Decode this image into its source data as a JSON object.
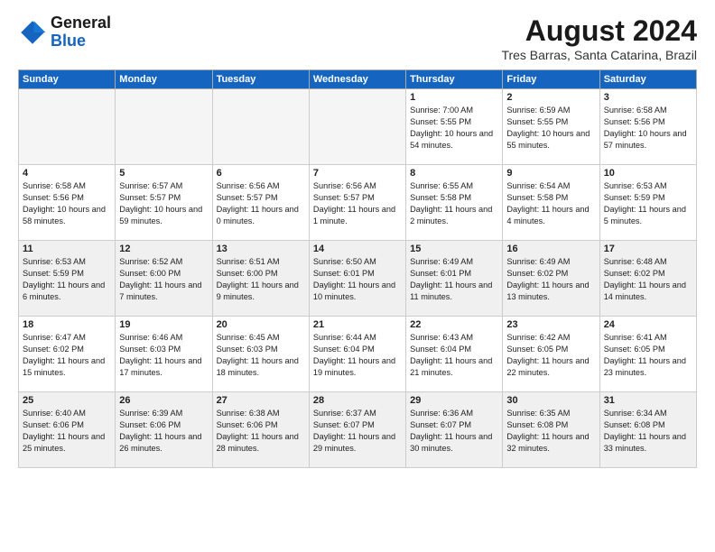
{
  "header": {
    "logo_general": "General",
    "logo_blue": "Blue",
    "month_title": "August 2024",
    "location": "Tres Barras, Santa Catarina, Brazil"
  },
  "weekdays": [
    "Sunday",
    "Monday",
    "Tuesday",
    "Wednesday",
    "Thursday",
    "Friday",
    "Saturday"
  ],
  "weeks": [
    [
      {
        "day": "",
        "empty": true
      },
      {
        "day": "",
        "empty": true
      },
      {
        "day": "",
        "empty": true
      },
      {
        "day": "",
        "empty": true
      },
      {
        "day": "1",
        "sunrise": "7:00 AM",
        "sunset": "5:55 PM",
        "daylight": "10 hours and 54 minutes."
      },
      {
        "day": "2",
        "sunrise": "6:59 AM",
        "sunset": "5:55 PM",
        "daylight": "10 hours and 55 minutes."
      },
      {
        "day": "3",
        "sunrise": "6:58 AM",
        "sunset": "5:56 PM",
        "daylight": "10 hours and 57 minutes."
      }
    ],
    [
      {
        "day": "4",
        "sunrise": "6:58 AM",
        "sunset": "5:56 PM",
        "daylight": "10 hours and 58 minutes."
      },
      {
        "day": "5",
        "sunrise": "6:57 AM",
        "sunset": "5:57 PM",
        "daylight": "10 hours and 59 minutes."
      },
      {
        "day": "6",
        "sunrise": "6:56 AM",
        "sunset": "5:57 PM",
        "daylight": "11 hours and 0 minutes."
      },
      {
        "day": "7",
        "sunrise": "6:56 AM",
        "sunset": "5:57 PM",
        "daylight": "11 hours and 1 minute."
      },
      {
        "day": "8",
        "sunrise": "6:55 AM",
        "sunset": "5:58 PM",
        "daylight": "11 hours and 2 minutes."
      },
      {
        "day": "9",
        "sunrise": "6:54 AM",
        "sunset": "5:58 PM",
        "daylight": "11 hours and 4 minutes."
      },
      {
        "day": "10",
        "sunrise": "6:53 AM",
        "sunset": "5:59 PM",
        "daylight": "11 hours and 5 minutes."
      }
    ],
    [
      {
        "day": "11",
        "sunrise": "6:53 AM",
        "sunset": "5:59 PM",
        "daylight": "11 hours and 6 minutes."
      },
      {
        "day": "12",
        "sunrise": "6:52 AM",
        "sunset": "6:00 PM",
        "daylight": "11 hours and 7 minutes."
      },
      {
        "day": "13",
        "sunrise": "6:51 AM",
        "sunset": "6:00 PM",
        "daylight": "11 hours and 9 minutes."
      },
      {
        "day": "14",
        "sunrise": "6:50 AM",
        "sunset": "6:01 PM",
        "daylight": "11 hours and 10 minutes."
      },
      {
        "day": "15",
        "sunrise": "6:49 AM",
        "sunset": "6:01 PM",
        "daylight": "11 hours and 11 minutes."
      },
      {
        "day": "16",
        "sunrise": "6:49 AM",
        "sunset": "6:02 PM",
        "daylight": "11 hours and 13 minutes."
      },
      {
        "day": "17",
        "sunrise": "6:48 AM",
        "sunset": "6:02 PM",
        "daylight": "11 hours and 14 minutes."
      }
    ],
    [
      {
        "day": "18",
        "sunrise": "6:47 AM",
        "sunset": "6:02 PM",
        "daylight": "11 hours and 15 minutes."
      },
      {
        "day": "19",
        "sunrise": "6:46 AM",
        "sunset": "6:03 PM",
        "daylight": "11 hours and 17 minutes."
      },
      {
        "day": "20",
        "sunrise": "6:45 AM",
        "sunset": "6:03 PM",
        "daylight": "11 hours and 18 minutes."
      },
      {
        "day": "21",
        "sunrise": "6:44 AM",
        "sunset": "6:04 PM",
        "daylight": "11 hours and 19 minutes."
      },
      {
        "day": "22",
        "sunrise": "6:43 AM",
        "sunset": "6:04 PM",
        "daylight": "11 hours and 21 minutes."
      },
      {
        "day": "23",
        "sunrise": "6:42 AM",
        "sunset": "6:05 PM",
        "daylight": "11 hours and 22 minutes."
      },
      {
        "day": "24",
        "sunrise": "6:41 AM",
        "sunset": "6:05 PM",
        "daylight": "11 hours and 23 minutes."
      }
    ],
    [
      {
        "day": "25",
        "sunrise": "6:40 AM",
        "sunset": "6:06 PM",
        "daylight": "11 hours and 25 minutes."
      },
      {
        "day": "26",
        "sunrise": "6:39 AM",
        "sunset": "6:06 PM",
        "daylight": "11 hours and 26 minutes."
      },
      {
        "day": "27",
        "sunrise": "6:38 AM",
        "sunset": "6:06 PM",
        "daylight": "11 hours and 28 minutes."
      },
      {
        "day": "28",
        "sunrise": "6:37 AM",
        "sunset": "6:07 PM",
        "daylight": "11 hours and 29 minutes."
      },
      {
        "day": "29",
        "sunrise": "6:36 AM",
        "sunset": "6:07 PM",
        "daylight": "11 hours and 30 minutes."
      },
      {
        "day": "30",
        "sunrise": "6:35 AM",
        "sunset": "6:08 PM",
        "daylight": "11 hours and 32 minutes."
      },
      {
        "day": "31",
        "sunrise": "6:34 AM",
        "sunset": "6:08 PM",
        "daylight": "11 hours and 33 minutes."
      }
    ]
  ]
}
